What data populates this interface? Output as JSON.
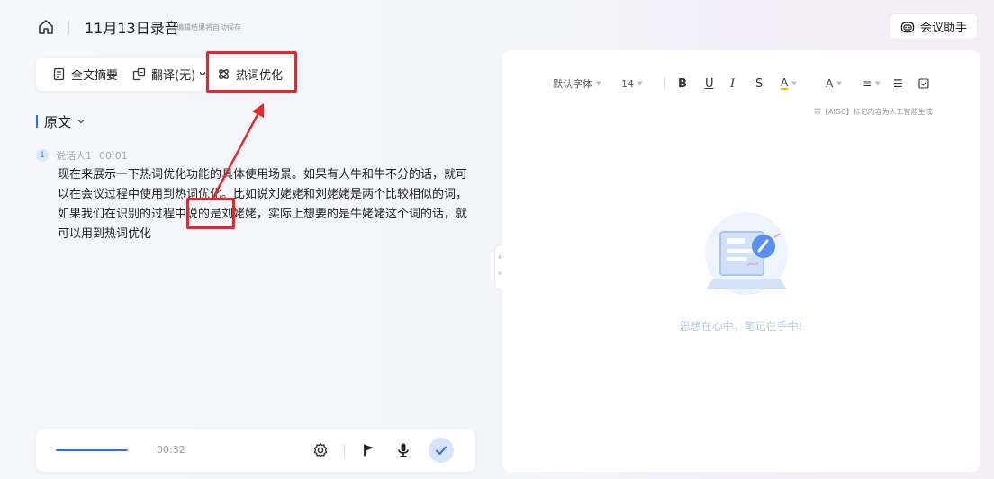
{
  "header": {
    "title": "11月13日录音",
    "autosave_note": "编辑结果将自动保存",
    "assistant_label": "会议助手"
  },
  "toolbar": {
    "summary_label": "全文摘要",
    "translate_label": "翻译(无)",
    "hotword_label": "热词优化"
  },
  "transcript": {
    "section_title": "原文",
    "speaker_index": "1",
    "speaker_name": "说话人1",
    "timestamp": "00:01",
    "text": "现在来展示一下热词优化功能的具体使用场景。如果有人牛和牛不分的话，就可以在会议过程中使用到热词优化。比如说刘姥姥和刘姥姥是两个比较相似的词，如果我们在识别的过程中说的是刘姥姥，实际上想要的是牛姥姥这个词的话，就可以用到热词优化"
  },
  "player": {
    "time": "00:32",
    "progress_fraction": 1.0
  },
  "editor": {
    "font_family": "默认字体",
    "font_size": "14",
    "bold": "B",
    "underline": "U",
    "italic": "I",
    "strike": "S",
    "highlight": "A",
    "font_color": "A",
    "aigc_note": "带【AIGC】标记内容为人工智能生成",
    "empty_text": "思想在心中，笔记在手中!"
  },
  "colors": {
    "accent": "#2f6bff",
    "highlight_box": "#e8262b"
  }
}
